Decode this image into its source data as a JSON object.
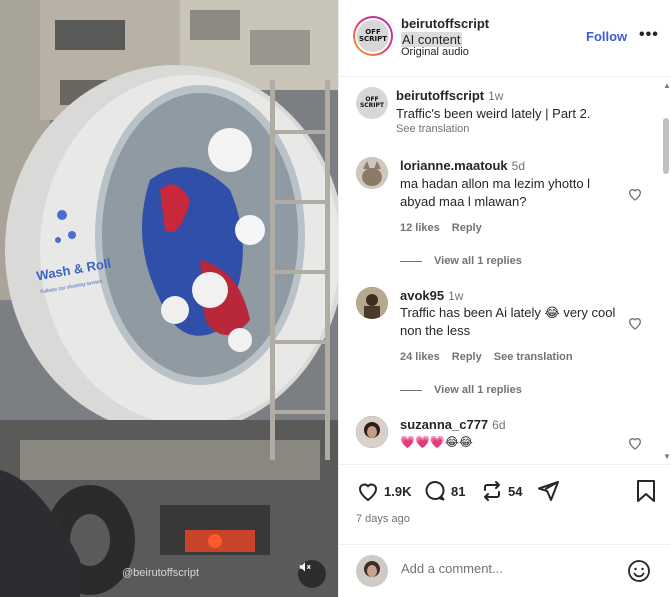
{
  "media": {
    "truck_text": "Wash & Roll",
    "truck_subtext": "Fullsize car cleaning service",
    "watermark": "@beirutoffscript",
    "mute_icon": "speaker-muted-icon"
  },
  "header": {
    "username": "beirutoffscript",
    "label": "AI content",
    "audio": "Original audio",
    "follow": "Follow",
    "more": "•••",
    "avatar_logo": "OFF SCRIPT"
  },
  "caption": {
    "username": "beirutoffscript",
    "time": "1w",
    "text": "Traffic's been weird lately | Part 2.",
    "see_translation": "See translation"
  },
  "comments": [
    {
      "username": "lorianne.maatouk",
      "time": "5d",
      "text": "ma hadan allon ma lezim yhotto l abyad maa l mlawan?",
      "likes": "12 likes",
      "reply": "Reply",
      "view_replies": "View all 1 replies"
    },
    {
      "username": "avok95",
      "time": "1w",
      "text": "Traffic has been Ai lately 😂 very cool non the less",
      "likes": "24 likes",
      "reply": "Reply",
      "see_translation": "See translation",
      "view_replies": "View all 1 replies"
    },
    {
      "username": "suzanna_c777",
      "time": "6d",
      "text": "💗💗💗😂😂"
    }
  ],
  "actions": {
    "likes": "1.9K",
    "comments": "81",
    "reposts": "54",
    "posted": "7 days ago"
  },
  "add_comment": {
    "placeholder": "Add a comment..."
  },
  "colors": {
    "accent": "#3f5bd6",
    "text": "#262626",
    "muted": "#737373",
    "border": "#efefef"
  }
}
